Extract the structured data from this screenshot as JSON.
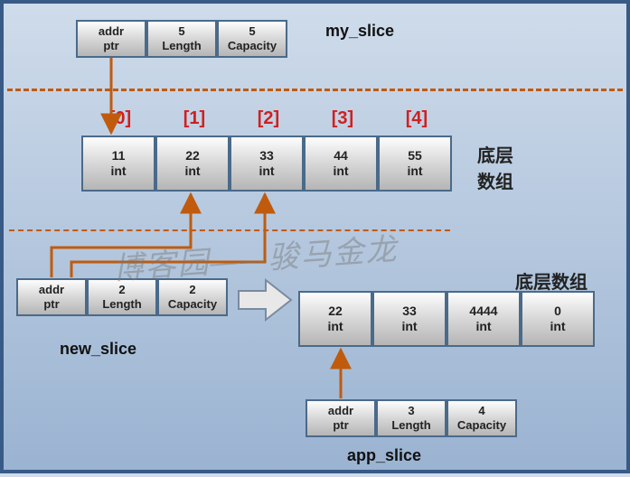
{
  "labels": {
    "my_slice": "my_slice",
    "new_slice": "new_slice",
    "app_slice": "app_slice",
    "underlying_array": "底层\n数组",
    "underlying_array_flat": "底层数组",
    "addr_top": "addr",
    "ptr": "ptr",
    "length": "Length",
    "capacity": "Capacity",
    "int": "int"
  },
  "my_slice": {
    "addr": "addr",
    "ptr": "ptr",
    "length": "5",
    "capacity": "5"
  },
  "new_slice": {
    "addr": "addr",
    "ptr": "ptr",
    "length": "2",
    "capacity": "2"
  },
  "app_slice": {
    "addr": "addr",
    "ptr": "ptr",
    "length": "3",
    "capacity": "4"
  },
  "arr1": {
    "indices": [
      "[0]",
      "[1]",
      "[2]",
      "[3]",
      "[4]"
    ],
    "values": [
      "11",
      "22",
      "33",
      "44",
      "55"
    ]
  },
  "arr2": {
    "values": [
      "22",
      "33",
      "4444",
      "0"
    ]
  },
  "watermark": "博客园——骏马金龙"
}
